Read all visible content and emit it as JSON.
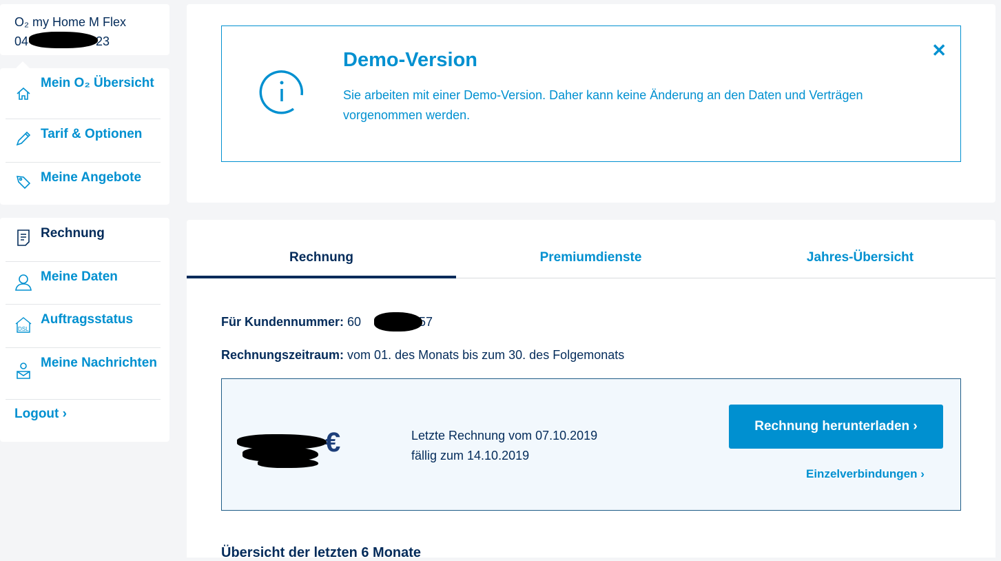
{
  "contract": {
    "name": "O₂ my Home M Flex",
    "number_prefix": "04",
    "number_suffix": "23"
  },
  "nav1": [
    {
      "label": "Mein O₂ Übersicht",
      "icon": "home-icon"
    },
    {
      "label": "Tarif & Optionen",
      "icon": "pencil-icon"
    },
    {
      "label": "Meine Angebote",
      "icon": "tag-icon"
    }
  ],
  "nav2": [
    {
      "label": "Rechnung",
      "icon": "invoice-icon",
      "active": true
    },
    {
      "label": "Meine Daten",
      "icon": "user-icon"
    },
    {
      "label": "Auftragsstatus",
      "icon": "dsl-house-icon"
    },
    {
      "label": "Meine Nachrichten",
      "icon": "message-icon"
    }
  ],
  "logout": "Logout ›",
  "demo": {
    "title": "Demo-Version",
    "text": "Sie arbeiten mit einer Demo-Version. Daher kann keine Änderung an den Daten und Verträgen vorgenommen werden.",
    "close": "✕"
  },
  "tabs": [
    {
      "label": "Rechnung",
      "active": true
    },
    {
      "label": "Premiumdienste"
    },
    {
      "label": "Jahres-Übersicht"
    }
  ],
  "customer": {
    "label": "Für Kundennummer:",
    "prefix": "60",
    "suffix": "57"
  },
  "period": {
    "label": "Rechnungszeitraum:",
    "value": "vom 01. des Monats bis zum 30. des Folgemonats"
  },
  "bill": {
    "currency": "€",
    "last": "Letzte Rechnung vom 07.10.2019",
    "due": "fällig zum 14.10.2019",
    "download": "Rechnung herunterladen ›",
    "details": "Einzelverbindungen ›"
  },
  "overview_heading": "Übersicht der letzten 6 Monate",
  "colors": {
    "accent": "#0090d0",
    "navy": "#032b5a"
  }
}
